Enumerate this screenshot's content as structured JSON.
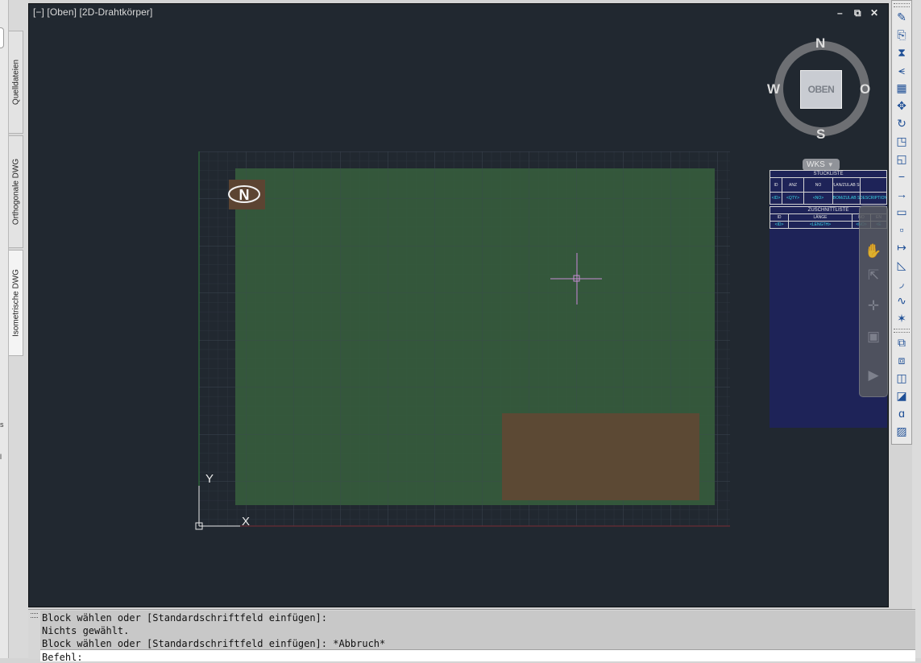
{
  "left_panel": {
    "tabs": [
      {
        "label": "Quelldateien"
      },
      {
        "label": "Orthogonale DWG"
      },
      {
        "label": "Isometrische DWG"
      }
    ],
    "cut_text": [
      "s",
      "l"
    ]
  },
  "viewport": {
    "title": "[−] [Oben] [2D-Drahtkörper]",
    "controls": {
      "minimize": "–",
      "restore": "⧉",
      "close": "✕"
    },
    "background_color": "#212830"
  },
  "viewcube": {
    "face_label": "OBEN",
    "compass": {
      "north": "N",
      "south": "S",
      "west": "W",
      "east": "O"
    },
    "wcs_label": "WKS"
  },
  "drawing": {
    "north_symbol_letter": "N",
    "ucs": {
      "x_label": "X",
      "y_label": "Y"
    },
    "colors": {
      "site": "#365b3d",
      "building": "#5c4934",
      "north_box": "#5c4432",
      "crosshair": "#c98ed4"
    }
  },
  "parts_table": {
    "stueckliste_title": "STÜCKLISTE",
    "stueckliste_headers": [
      "ID",
      "ANZ",
      "NO",
      "PLAN/ZULAB SE",
      ""
    ],
    "stueckliste_values": [
      "<ID>",
      "<QTY>",
      "<NO>",
      "<BOM/ZULAB S>",
      "<DESCRIPTION>"
    ],
    "zuschnitt_title": "ZUSCHNITTLISTE",
    "zuschnitt_headers": [
      "ID",
      "LÄNGE",
      "NO",
      "EN"
    ],
    "zuschnitt_values": [
      "<ID>",
      "<LENGTH>",
      "<NO>",
      "<E"
    ]
  },
  "toolbar": {
    "icons": [
      "paintbrush-icon",
      "copy-icon",
      "mirror-icon",
      "offset-icon",
      "array-icon",
      "move-icon",
      "rotate-icon",
      "scale-icon",
      "stretch-icon",
      "trim-icon",
      "extend-icon",
      "break-at-point-icon",
      "break-icon",
      "join-icon",
      "chamfer-icon",
      "fillet-icon",
      "blend-icon",
      "explode-icon",
      "draworder-front-icon",
      "draworder-back-icon",
      "draworder-above-icon",
      "draworder-under-icon",
      "text-to-front-icon",
      "hatch-to-back-icon"
    ]
  },
  "command_line": {
    "history": [
      "Block wählen oder [Standardschriftfeld einfügen]:",
      "Nichts gewählt.",
      "Block wählen oder [Standardschriftfeld einfügen]: *Abbruch*"
    ],
    "prompt": "Befehl:"
  }
}
